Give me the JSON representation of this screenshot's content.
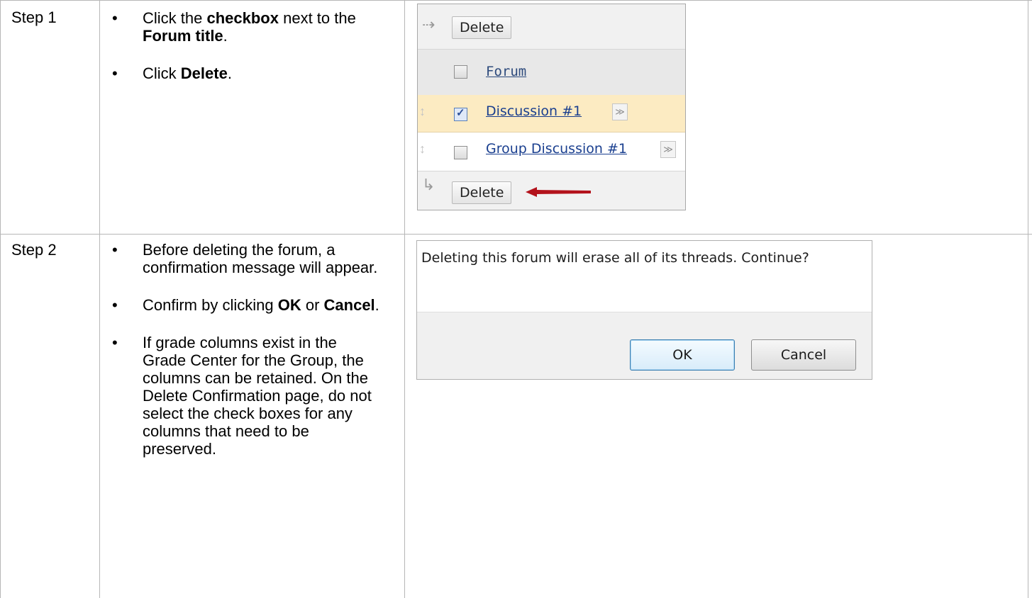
{
  "steps": [
    {
      "label": "Step 1",
      "bullets": [
        {
          "pre": "Click the ",
          "b1": "checkbox",
          "mid": " next to the ",
          "b2": "Forum title",
          "post": "."
        },
        {
          "pre": "Click ",
          "b1": "Delete",
          "post": "."
        }
      ]
    },
    {
      "label": "Step 2",
      "bullets": [
        {
          "text": "Before deleting the forum, a confirmation message will appear."
        },
        {
          "pre": "Confirm by clicking ",
          "b1": "OK",
          "mid": " or ",
          "b2": "Cancel",
          "post": "."
        },
        {
          "text": "If grade columns exist in the Grade Center for the Group, the columns can be retained. On the Delete Confirmation page, do not select the check boxes for any columns that need to be preserved."
        }
      ]
    }
  ],
  "bullet_glyph": "•",
  "forum_screenshot": {
    "top_delete_label": "Delete",
    "header_label": "Forum",
    "rows": [
      {
        "title": "Discussion #1",
        "checked": true
      },
      {
        "title": "Group Discussion #1",
        "checked": false
      }
    ],
    "bottom_delete_label": "Delete",
    "highlight_color": "#fcebc2",
    "arrow_color": "#b3121b"
  },
  "confirm_dialog": {
    "message": "Deleting this forum will erase all of its threads. Continue?",
    "ok_label": "OK",
    "cancel_label": "Cancel"
  }
}
